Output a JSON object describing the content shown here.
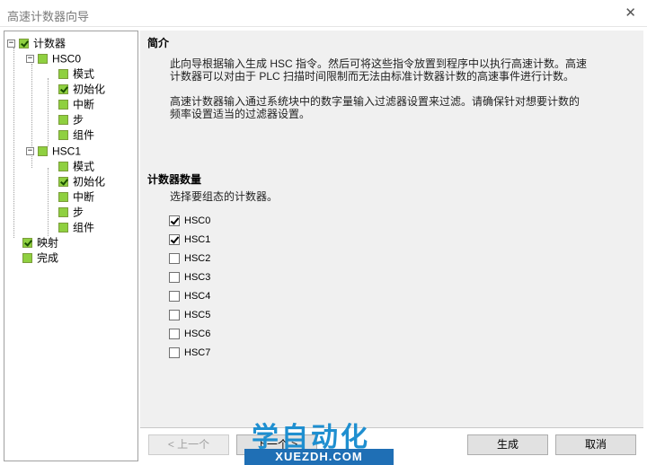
{
  "window": {
    "title": "高速计数器向导",
    "close_glyph": "✕"
  },
  "tree": {
    "counters": "计数器",
    "hsc0": "HSC0",
    "hsc0_children": [
      "模式",
      "初始化",
      "中断",
      "步",
      "组件"
    ],
    "hsc1": "HSC1",
    "hsc1_children": [
      "模式",
      "初始化",
      "中断",
      "步",
      "组件"
    ],
    "mapping": "映射",
    "finish": "完成"
  },
  "intro": {
    "title": "简介",
    "para1_line1": "此向导根据输入生成 HSC 指令。然后可将这些指令放置到程序中以执行高速计数。高速",
    "para1_line2": "计数器可以对由于 PLC 扫描时间限制而无法由标准计数器计数的高速事件进行计数。",
    "para2_line1": "高速计数器输入通过系统块中的数字量输入过滤器设置来过滤。请确保针对想要计数的",
    "para2_line2": "频率设置适当的过滤器设置。"
  },
  "counter_count": {
    "title": "计数器数量",
    "prompt": "选择要组态的计数器。",
    "items": [
      {
        "label": "HSC0",
        "checked": true
      },
      {
        "label": "HSC1",
        "checked": true
      },
      {
        "label": "HSC2",
        "checked": false
      },
      {
        "label": "HSC3",
        "checked": false
      },
      {
        "label": "HSC4",
        "checked": false
      },
      {
        "label": "HSC5",
        "checked": false
      },
      {
        "label": "HSC6",
        "checked": false
      },
      {
        "label": "HSC7",
        "checked": false
      }
    ]
  },
  "buttons": {
    "prev": "< 上一个",
    "next": "下一个 >",
    "generate": "生成",
    "cancel": "取消"
  },
  "watermark": {
    "cn": "学自动化",
    "en": "XUEZDH.COM"
  },
  "colors": {
    "tree_box": "#8fd040",
    "watermark_blue": "#1f6fb5"
  }
}
